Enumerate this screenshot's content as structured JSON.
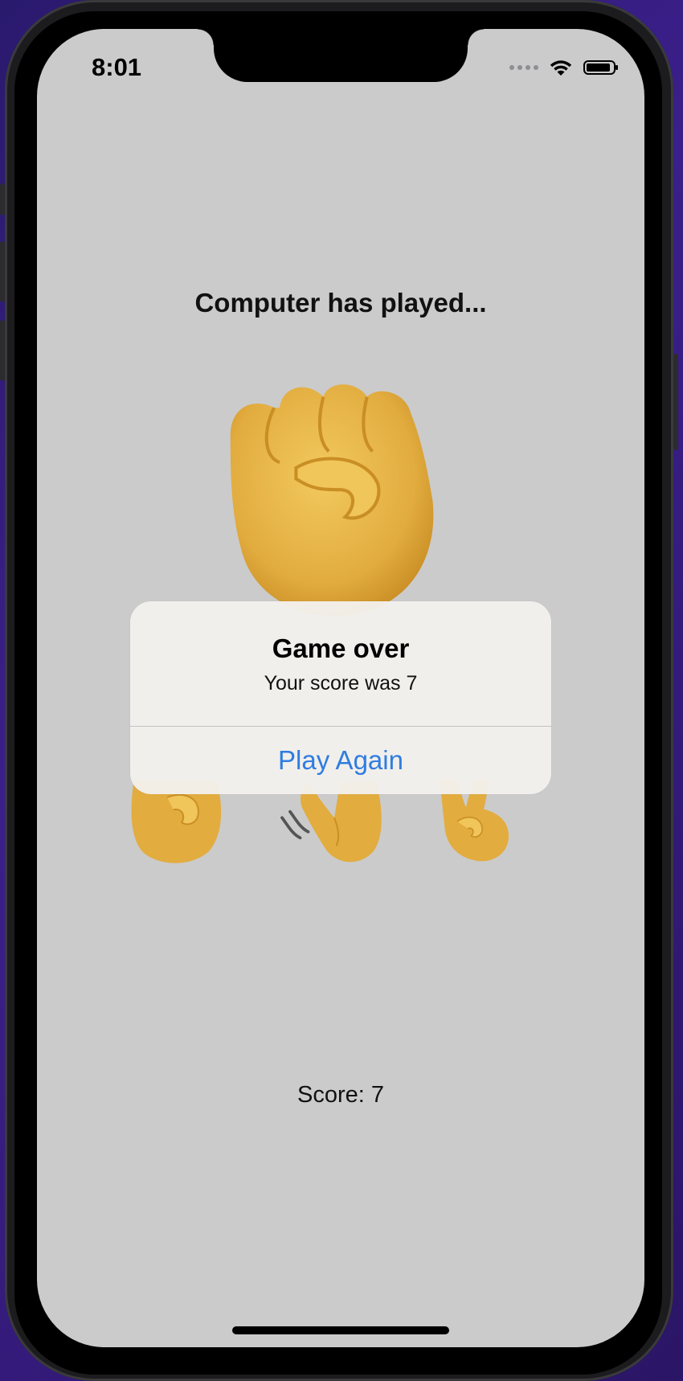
{
  "status_bar": {
    "time": "8:01",
    "icons": [
      "cellular-dots-icon",
      "wifi-icon",
      "battery-icon"
    ],
    "battery_level": 0.9
  },
  "game": {
    "heading": "Computer has played...",
    "computer_move": "rock",
    "choices": [
      "rock",
      "paper",
      "scissors"
    ],
    "score_text": "Score: 7"
  },
  "alert": {
    "title": "Game over",
    "message": "Your score was 7",
    "button_label": "Play Again"
  },
  "colors": {
    "background": "#cbcbcb",
    "accent": "#2f7de0",
    "skin": "#e7b54a"
  }
}
